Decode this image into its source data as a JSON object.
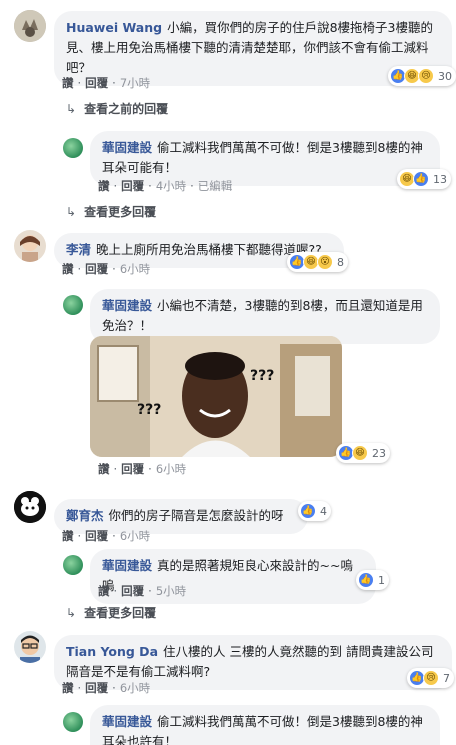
{
  "comments": [
    {
      "name": "Huawei Wang",
      "text": "小編，買你們的房子的住戶說8樓拖椅子3樓聽的見、樓上用免治馬桶樓下聽的清清楚楚耶，你們該不會有偷工減料吧？",
      "like": "讚",
      "reply": "回覆",
      "time": "7小時",
      "react_count": "30"
    },
    {
      "name": "華固建設",
      "text": "偷工減料我們萬萬不可做！倒是3樓聽到8樓的神耳朵可能有！",
      "like": "讚",
      "reply": "回覆",
      "time": "4小時",
      "edited": "已編輯",
      "react_count": "13"
    },
    {
      "name": "李清",
      "text": "晚上上廁所用免治馬桶樓下都聽得道喔??",
      "like": "讚",
      "reply": "回覆",
      "time": "6小時",
      "react_count": "8"
    },
    {
      "name": "華固建設",
      "text": "小編也不清楚，3樓聽的到8樓，而且還知道是用免治？！",
      "like": "讚",
      "reply": "回覆",
      "time": "6小時",
      "react_count": "23",
      "image_marks": [
        "???",
        "???"
      ]
    },
    {
      "name": "鄭育杰",
      "text": "你們的房子隔音是怎麼設計的呀",
      "like": "讚",
      "reply": "回覆",
      "time": "6小時",
      "react_count": "4"
    },
    {
      "name": "華固建設",
      "text": "真的是照著規矩良心來設計的~~嗚嗚",
      "like": "讚",
      "reply": "回覆",
      "time": "5小時",
      "react_count": "1"
    },
    {
      "name": "Tian Yong Da",
      "text": "住八樓的人 三樓的人竟然聽的到 請問貴建設公司隔音是不是有偷工減料啊?",
      "like": "讚",
      "reply": "回覆",
      "time": "6小時",
      "react_count": "7"
    },
    {
      "name": "華固建設",
      "text": "偷工減料我們萬萬不可做！倒是3樓聽到8樓的神耳朵也許有！"
    }
  ],
  "view_previous": "查看之前的回覆",
  "view_more_1": "查看更多回覆",
  "view_more_2": "查看更多回覆",
  "icons": {
    "like": "👍",
    "haha": "😆",
    "wow": "😮",
    "sad": "😢",
    "reply_arrow": "↳"
  },
  "colors": {
    "name": "#385898",
    "bubble": "#f2f3f5",
    "like": "#4a7ff0"
  }
}
